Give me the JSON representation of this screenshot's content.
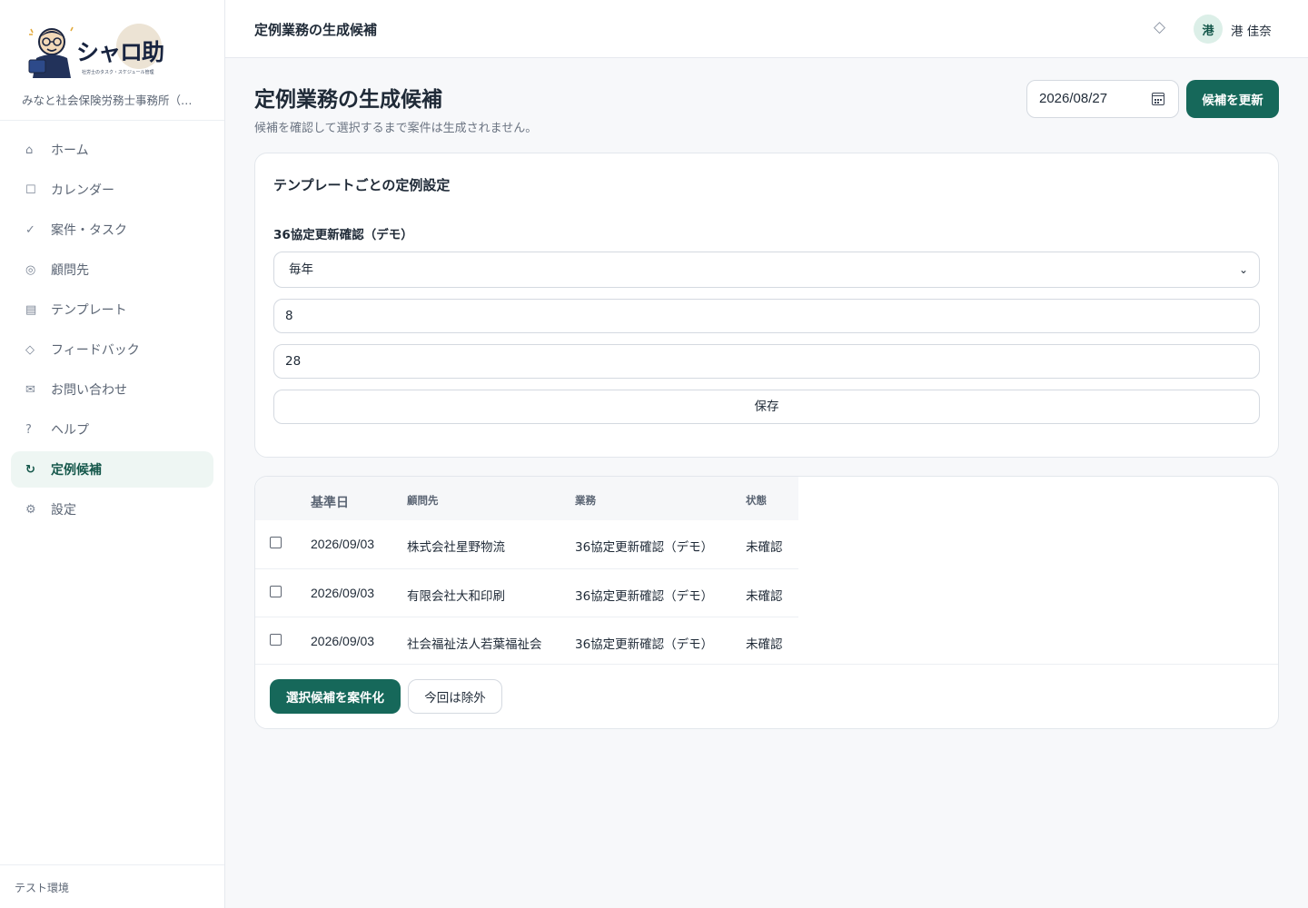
{
  "app": {
    "logo_text": "シャロ助",
    "logo_ruby": "すけ",
    "logo_sub": "社労士のタスク・スケジュール管理",
    "office_name": "みなと社会保険労務士事務所（デモ）",
    "environment_label": "テスト環境"
  },
  "sidebar": {
    "items": [
      {
        "label": "ホーム",
        "icon": "home-icon",
        "glyph": "⌂",
        "active": false
      },
      {
        "label": "カレンダー",
        "icon": "calendar-icon",
        "glyph": "☐",
        "active": false
      },
      {
        "label": "案件・タスク",
        "icon": "check-icon",
        "glyph": "✓",
        "active": false
      },
      {
        "label": "顧問先",
        "icon": "clients-icon",
        "glyph": "◎",
        "active": false
      },
      {
        "label": "テンプレート",
        "icon": "template-icon",
        "glyph": "▤",
        "active": false
      },
      {
        "label": "フィードバック",
        "icon": "feedback-icon",
        "glyph": "◇",
        "active": false
      },
      {
        "label": "お問い合わせ",
        "icon": "mail-icon",
        "glyph": "✉",
        "active": false
      },
      {
        "label": "ヘルプ",
        "icon": "help-icon",
        "glyph": "?",
        "active": false
      },
      {
        "label": "定例候補",
        "icon": "refresh-icon",
        "glyph": "↻",
        "active": true
      },
      {
        "label": "設定",
        "icon": "gear-icon",
        "glyph": "⚙",
        "active": false
      }
    ]
  },
  "topbar": {
    "title": "定例業務の生成候補",
    "bell_icon": "diamond-icon",
    "bell_glyph": "◇",
    "avatar_initial": "港",
    "user_name": "港 佳奈"
  },
  "page": {
    "title": "定例業務の生成候補",
    "subtitle": "候補を確認して選択するまで案件は生成されません。",
    "date_value": "2026/08/27",
    "refresh_label": "候補を更新"
  },
  "settings": {
    "card_title": "テンプレートごとの定例設定",
    "template_name": "36協定更新確認（デモ）",
    "frequency_value": "毎年",
    "frequency_options": [
      "毎年"
    ],
    "month_value": "8",
    "day_value": "28",
    "save_label": "保存"
  },
  "candidates": {
    "columns": {
      "date": "基準日",
      "client": "顧問先",
      "task": "業務",
      "status": "状態"
    },
    "rows": [
      {
        "date": "2026/09/03",
        "client": "株式会社星野物流",
        "task": "36協定更新確認（デモ）",
        "status": "未確認",
        "checked": false
      },
      {
        "date": "2026/09/03",
        "client": "有限会社大和印刷",
        "task": "36協定更新確認（デモ）",
        "status": "未確認",
        "checked": false
      },
      {
        "date": "2026/09/03",
        "client": "社会福祉法人若葉福祉会",
        "task": "36協定更新確認（デモ）",
        "status": "未確認",
        "checked": false
      }
    ],
    "create_label": "選択候補を案件化",
    "exclude_label": "今回は除外"
  },
  "colors": {
    "accent": "#16685a",
    "active_bg": "#eef6f3",
    "border": "#e3e7ec",
    "page_bg": "#f7f8fa"
  }
}
